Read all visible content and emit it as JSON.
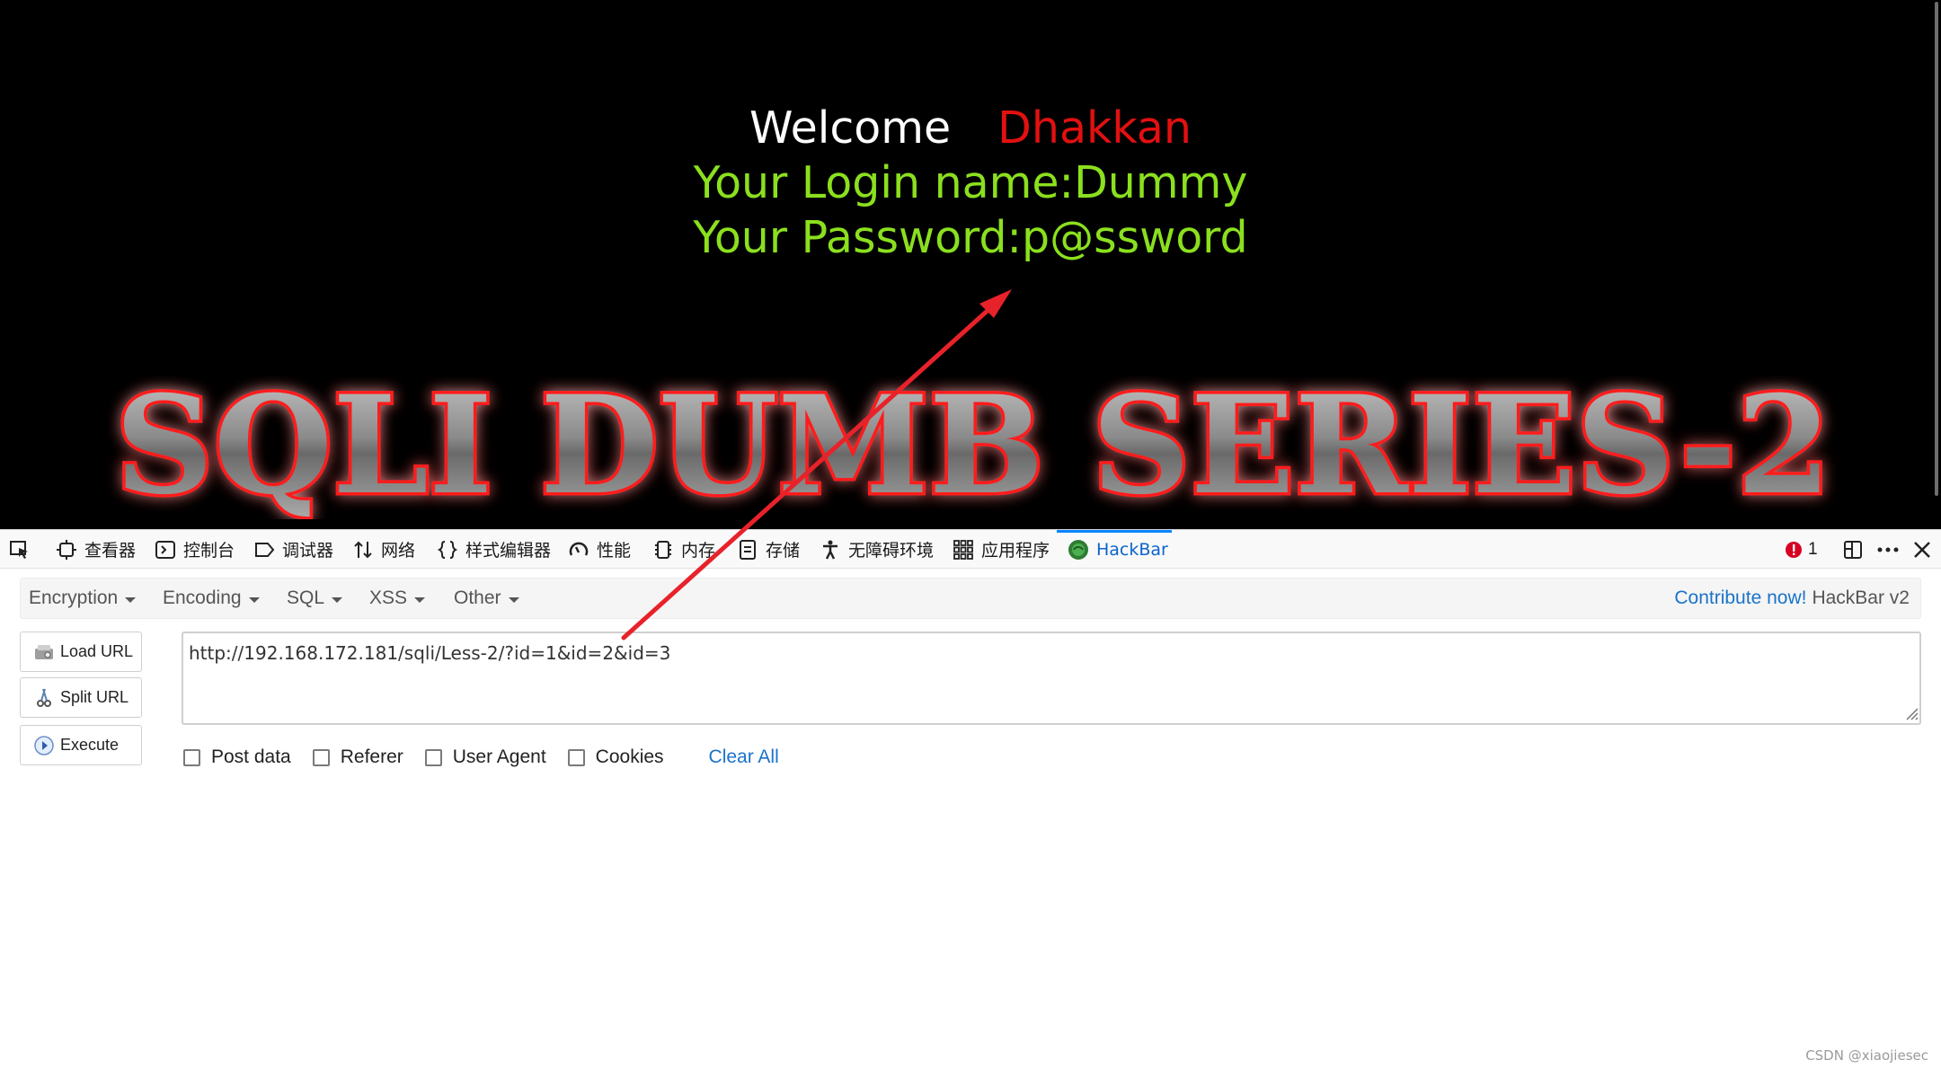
{
  "webpage": {
    "welcome_word": "Welcome",
    "welcome_name": "Dhakkan",
    "login_line": "Your Login name:Dummy",
    "password_line": "Your Password:p@ssword",
    "banner_text": "SQLI DUMB SERIES-2"
  },
  "devtools": {
    "tabs": [
      {
        "label": "查看器",
        "icon": "inspector-icon"
      },
      {
        "label": "控制台",
        "icon": "console-icon"
      },
      {
        "label": "调试器",
        "icon": "debugger-icon"
      },
      {
        "label": "网络",
        "icon": "network-icon"
      },
      {
        "label": "样式编辑器",
        "icon": "style-editor-icon"
      },
      {
        "label": "性能",
        "icon": "performance-icon"
      },
      {
        "label": "内存",
        "icon": "memory-icon"
      },
      {
        "label": "存储",
        "icon": "storage-icon"
      },
      {
        "label": "无障碍环境",
        "icon": "accessibility-icon"
      },
      {
        "label": "应用程序",
        "icon": "application-icon"
      },
      {
        "label": "HackBar",
        "icon": "hackbar-icon"
      }
    ],
    "active_tab": "HackBar",
    "error_count": "1",
    "accent_color": "#0a84ff"
  },
  "hackbar": {
    "menus": [
      {
        "label": "Encryption"
      },
      {
        "label": "Encoding"
      },
      {
        "label": "SQL"
      },
      {
        "label": "XSS"
      },
      {
        "label": "Other"
      }
    ],
    "contribute_link": "Contribute now!",
    "version": "HackBar v2",
    "buttons": {
      "load_url": "Load URL",
      "split_url": "Split URL",
      "execute": "Execute"
    },
    "url_value": "http://192.168.172.181/sqli/Less-2/?id=1&id=2&id=3",
    "options": {
      "post_data": "Post data",
      "referer": "Referer",
      "user_agent": "User Agent",
      "cookies": "Cookies"
    },
    "clear_all": "Clear All"
  },
  "watermark": "CSDN @xiaojiesec",
  "colors": {
    "welcome_name": "#e21010",
    "credentials": "#8be01e",
    "annotation_arrow": "#e8222a",
    "link": "#1a73c9"
  }
}
